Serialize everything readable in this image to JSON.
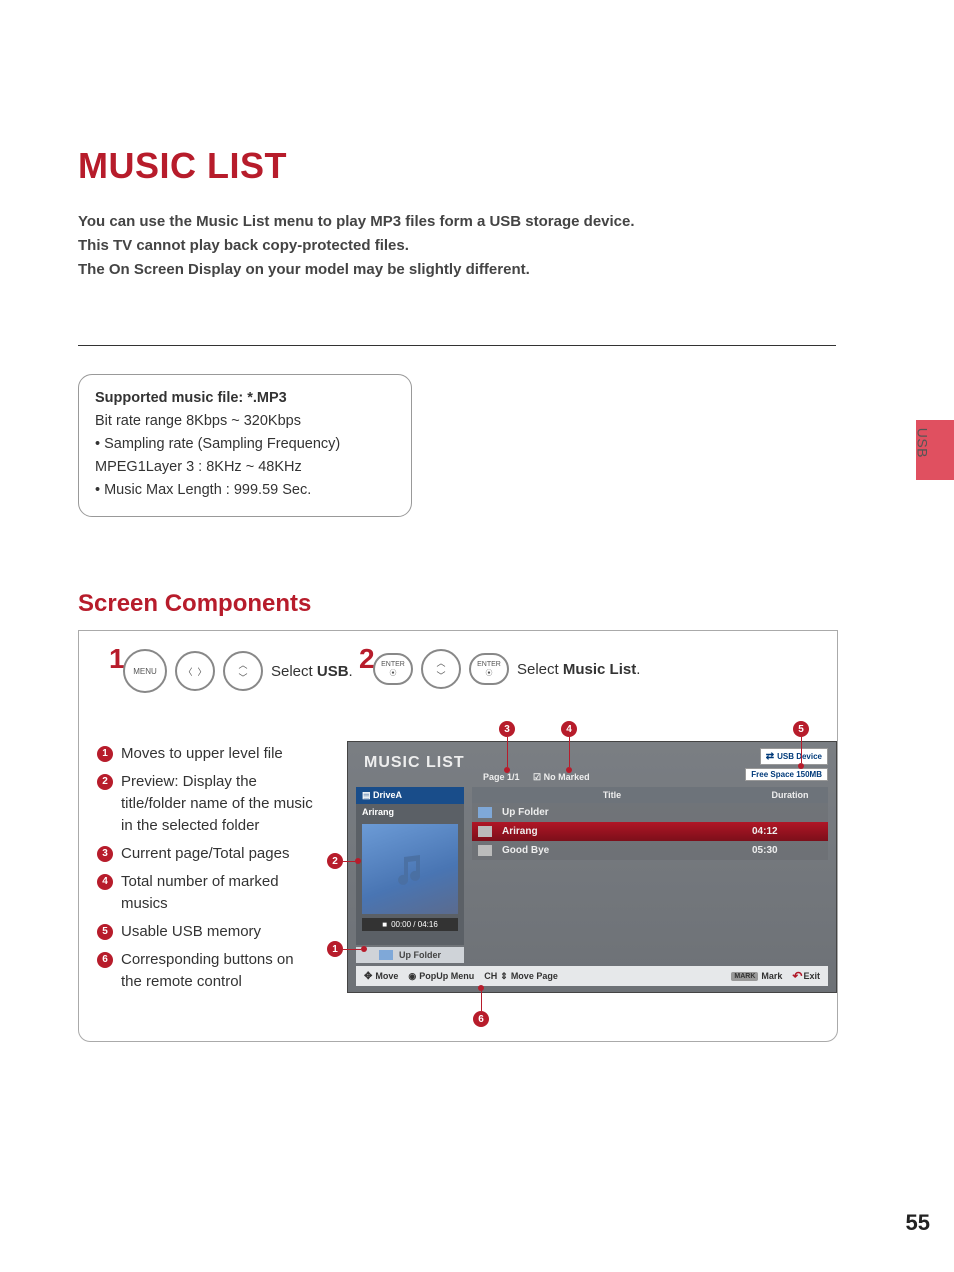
{
  "page": {
    "title": "MUSIC LIST",
    "intro_line1": "You can use the Music List menu to play MP3 files form a USB storage device.",
    "intro_line2": "This TV cannot play back copy-protected files.",
    "intro_line3": "The On Screen Display on your model may be slightly different.",
    "page_number": "55",
    "side_tab": "USB"
  },
  "spec": {
    "heading": "Supported music file: *.MP3",
    "line1": "Bit rate range 8Kbps ~ 320Kbps",
    "bullet1": "• Sampling rate (Sampling Frequency) MPEG1Layer 3 : 8KHz ~ 48KHz",
    "bullet2": "• Music Max Length : 999.59 Sec."
  },
  "section_heading": "Screen Components",
  "instruct": {
    "step1_num": "1",
    "step1_menu": "MENU",
    "step1_text_a": "Select ",
    "step1_text_b": "USB",
    "step1_text_c": ".",
    "step2_num": "2",
    "step2_enter": "ENTER",
    "step2_text_a": "Select ",
    "step2_text_b": "Music List",
    "step2_text_c": "."
  },
  "explain": {
    "items": [
      {
        "n": "1",
        "txt": "Moves to upper level file"
      },
      {
        "n": "2",
        "txt": "Preview: Display the title/folder name of the music in the selected folder"
      },
      {
        "n": "3",
        "txt": "Current page/Total pages"
      },
      {
        "n": "4",
        "txt": "Total number of marked musics"
      },
      {
        "n": "5",
        "txt": "Usable USB memory"
      },
      {
        "n": "6",
        "txt": "Corresponding buttons on the remote control"
      }
    ]
  },
  "tv": {
    "title": "MUSIC LIST",
    "page": "Page 1/1",
    "nomarked_icon": "☑",
    "nomarked": "No Marked",
    "usb_device": "USB Device",
    "free_space": "Free Space 150MB",
    "drive": "DriveA",
    "current_folder": "Arirang",
    "playtime": "00:00 / 04:16",
    "upfolder": "Up Folder",
    "col_title": "Title",
    "col_duration": "Duration",
    "rows": [
      {
        "kind": "up",
        "name": "Up Folder",
        "dur": ""
      },
      {
        "kind": "active",
        "name": "Arirang",
        "dur": "04:12"
      },
      {
        "kind": "file",
        "name": "Good Bye",
        "dur": "05:30"
      }
    ],
    "bottombar": {
      "move": "Move",
      "popup": "PopUp Menu",
      "chmove_prefix": "CH",
      "chmove": "Move Page",
      "mark_key": "MARK",
      "mark": "Mark",
      "exit": "Exit"
    }
  },
  "callouts": {
    "b1": "1",
    "b2": "2",
    "b3": "3",
    "b4": "4",
    "b5": "5",
    "b6": "6"
  },
  "colors": {
    "accent": "#b71c2b"
  }
}
